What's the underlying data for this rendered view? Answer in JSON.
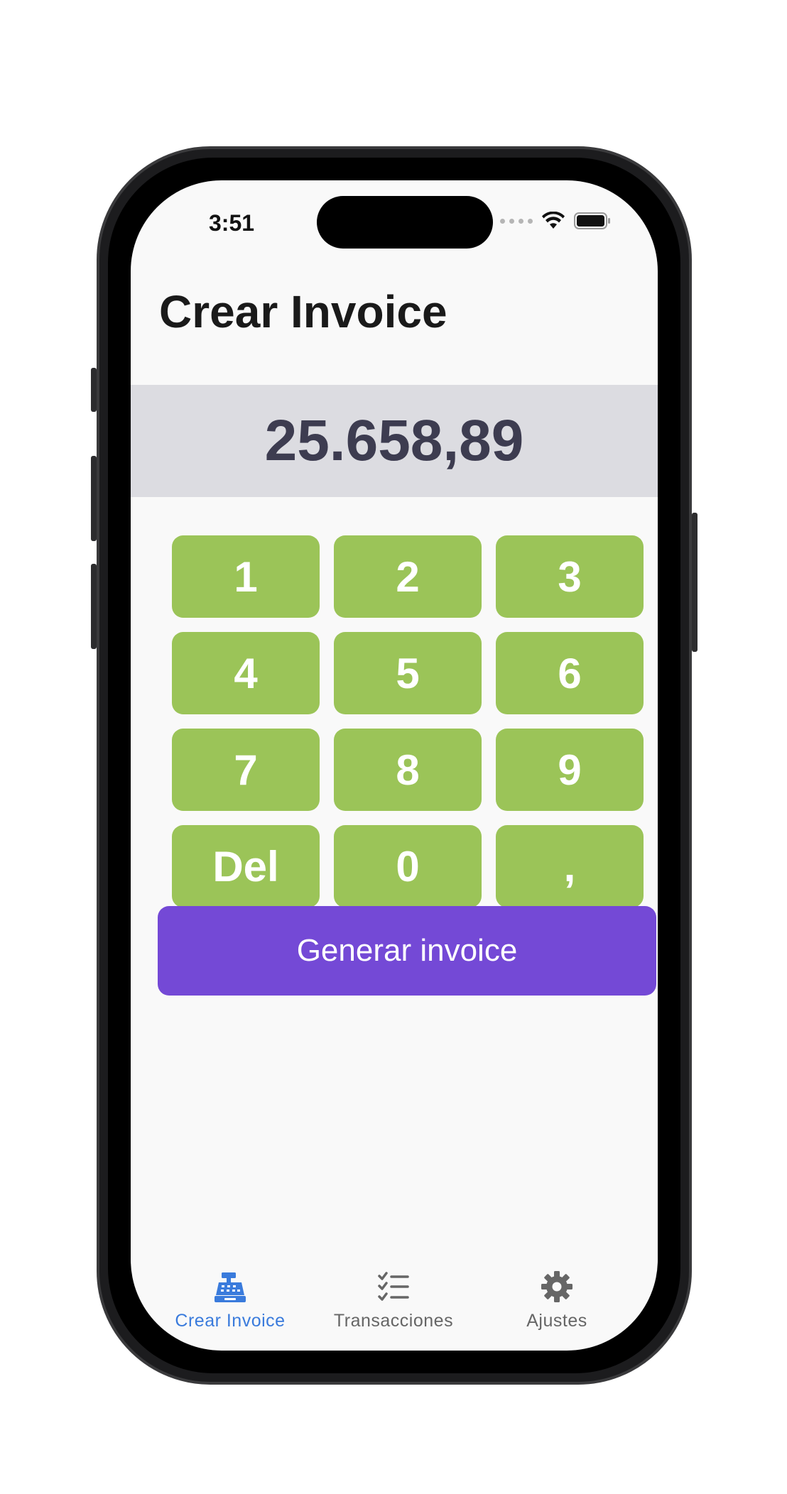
{
  "status_bar": {
    "time": "3:51"
  },
  "header": {
    "title": "Crear Invoice"
  },
  "amount": {
    "value": "25.658,89"
  },
  "keypad": {
    "keys": [
      "1",
      "2",
      "3",
      "4",
      "5",
      "6",
      "7",
      "8",
      "9",
      "Del",
      "0",
      ","
    ]
  },
  "generate_button": {
    "label": "Generar invoice"
  },
  "tabbar": {
    "tabs": [
      {
        "label": "Crear Invoice",
        "icon": "cash-register-icon",
        "active": true
      },
      {
        "label": "Transacciones",
        "icon": "checklist-icon",
        "active": false
      },
      {
        "label": "Ajustes",
        "icon": "gear-icon",
        "active": false
      }
    ]
  },
  "colors": {
    "accent": "#7449d6",
    "keypad": "#9bc458",
    "active_tab": "#3a7bdc",
    "amount_bg": "#dcdce1"
  }
}
